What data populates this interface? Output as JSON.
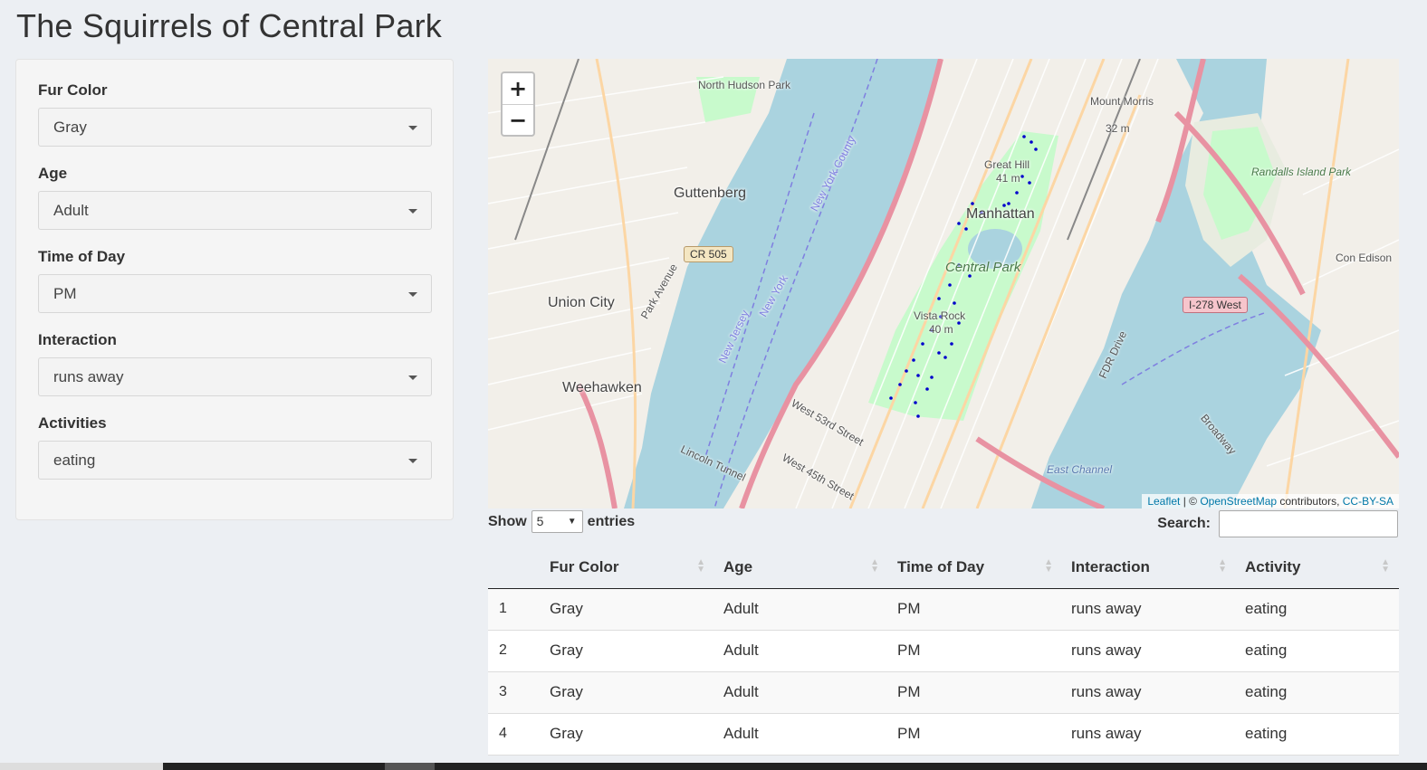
{
  "page": {
    "title": "The Squirrels of Central Park"
  },
  "filters": [
    {
      "label": "Fur Color",
      "value": "Gray"
    },
    {
      "label": "Age",
      "value": "Adult"
    },
    {
      "label": "Time of Day",
      "value": "PM"
    },
    {
      "label": "Interaction",
      "value": "runs away"
    },
    {
      "label": "Activities",
      "value": "eating"
    }
  ],
  "map": {
    "zoom_in": "+",
    "zoom_out": "−",
    "labels": {
      "guttenberg": "Guttenberg",
      "union_city": "Union City",
      "weehawken": "Weehawken",
      "manhattan": "Manhattan",
      "central_park": "Central Park",
      "great_hill": "Great Hill",
      "great_hill_elev": "41 m",
      "vista_rock": "Vista Rock",
      "vista_rock_elev": "40 m",
      "mount_morris": "Mount Morris",
      "mount_morris_elev": "32 m",
      "north_hudson_park": "North Hudson Park",
      "randalls_island_park": "Randalls Island Park",
      "con_edison": "Con Edison",
      "east_channel": "East Channel",
      "new_york": "New York",
      "new_jersey": "New Jersey",
      "new_york_county": "New York County",
      "park_avenue": "Park Avenue",
      "broadway": "Broadway",
      "lincoln_tunnel": "Lincoln Tunnel",
      "west_53rd": "West 53rd Street",
      "west_45th": "West 45th Street",
      "fdr_drive": "FDR Drive"
    },
    "shields": {
      "cr505": "CR 505",
      "i278": "I-278 West"
    },
    "attribution": {
      "leaflet": "Leaflet",
      "sep": " | © ",
      "osm": "OpenStreetMap",
      "contributors": " contributors, ",
      "license": "CC-BY-SA"
    },
    "points_label": "squirrel sightings"
  },
  "table": {
    "show_label": "Show",
    "page_length": "5",
    "entries_label": "entries",
    "search_label": "Search:",
    "search_value": "",
    "columns": [
      "Fur Color",
      "Age",
      "Time of Day",
      "Interaction",
      "Activity"
    ],
    "rows": [
      {
        "idx": "1",
        "fur": "Gray",
        "age": "Adult",
        "time": "PM",
        "interaction": "runs away",
        "activity": "eating"
      },
      {
        "idx": "2",
        "fur": "Gray",
        "age": "Adult",
        "time": "PM",
        "interaction": "runs away",
        "activity": "eating"
      },
      {
        "idx": "3",
        "fur": "Gray",
        "age": "Adult",
        "time": "PM",
        "interaction": "runs away",
        "activity": "eating"
      },
      {
        "idx": "4",
        "fur": "Gray",
        "age": "Adult",
        "time": "PM",
        "interaction": "runs away",
        "activity": "eating"
      }
    ]
  },
  "colors": {
    "water": "#aad3df",
    "park": "#c8facc",
    "land": "#f2efe9",
    "road_major": "#e892a2",
    "road_secondary": "#fcd6a4",
    "marker": "#0000cc"
  }
}
